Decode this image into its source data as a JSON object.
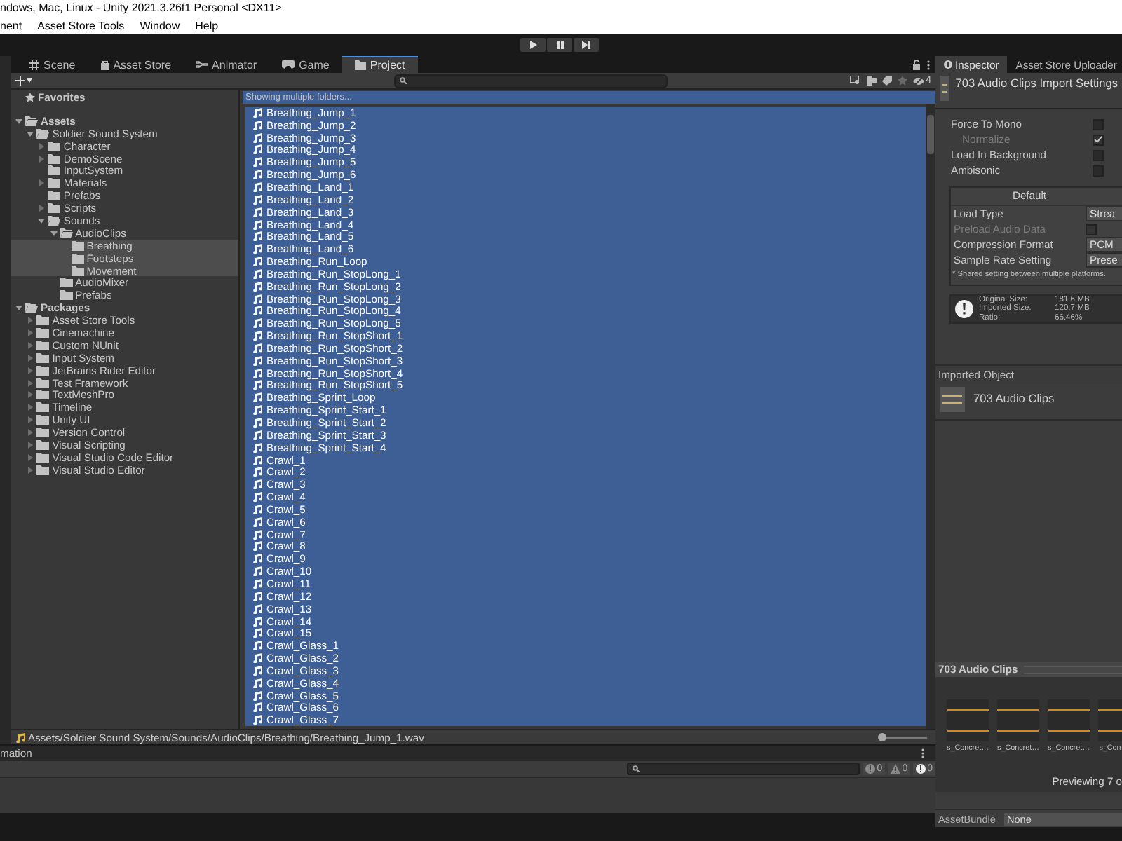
{
  "window": {
    "title": "ndows, Mac, Linux - Unity 2021.3.26f1 Personal <DX11>"
  },
  "menu": [
    "nent",
    "Asset Store Tools",
    "Window",
    "Help"
  ],
  "tabs": [
    {
      "label": "Scene",
      "kind": "scene",
      "selected": false
    },
    {
      "label": "Asset Store",
      "kind": "store",
      "selected": false
    },
    {
      "label": "Animator",
      "kind": "animator",
      "selected": false
    },
    {
      "label": "Game",
      "kind": "game",
      "selected": false
    },
    {
      "label": "Project",
      "kind": "project",
      "selected": true
    }
  ],
  "project_toolbar": {
    "hidden_count": "4"
  },
  "tree": [
    {
      "label": "Favorites",
      "kind": "favorites",
      "selected": false
    },
    {
      "label": "Assets",
      "kind": "folder",
      "expanded": true,
      "selected": false,
      "children": [
        {
          "label": "Soldier Sound System",
          "kind": "folder",
          "expanded": true,
          "selected": false,
          "children": [
            {
              "label": "Character",
              "kind": "folder",
              "expanded": false,
              "selected": false
            },
            {
              "label": "DemoScene",
              "kind": "folder",
              "expanded": false,
              "selected": false
            },
            {
              "label": "InputSystem",
              "kind": "empty_folder",
              "selected": false
            },
            {
              "label": "Materials",
              "kind": "folder",
              "expanded": false,
              "selected": false
            },
            {
              "label": "Prefabs",
              "kind": "empty_folder",
              "selected": false
            },
            {
              "label": "Scripts",
              "kind": "folder",
              "expanded": false,
              "selected": false
            },
            {
              "label": "Sounds",
              "kind": "folder",
              "expanded": true,
              "selected": false,
              "children": [
                {
                  "label": "AudioClips",
                  "kind": "folder",
                  "expanded": true,
                  "selected": false,
                  "children": [
                    {
                      "label": "Breathing",
                      "kind": "empty_folder",
                      "selected": true
                    },
                    {
                      "label": "Footsteps",
                      "kind": "empty_folder",
                      "selected": true
                    },
                    {
                      "label": "Movement",
                      "kind": "empty_folder",
                      "selected": true
                    }
                  ]
                },
                {
                  "label": "AudioMixer",
                  "kind": "empty_folder",
                  "selected": false
                },
                {
                  "label": "Prefabs",
                  "kind": "empty_folder",
                  "selected": false
                }
              ]
            }
          ]
        }
      ]
    },
    {
      "label": "Packages",
      "kind": "folder",
      "expanded": true,
      "selected": false,
      "children": [
        {
          "label": "Asset Store Tools",
          "kind": "folder",
          "expanded": false,
          "selected": false
        },
        {
          "label": "Cinemachine",
          "kind": "folder",
          "expanded": false,
          "selected": false
        },
        {
          "label": "Custom NUnit",
          "kind": "folder",
          "expanded": false,
          "selected": false
        },
        {
          "label": "Input System",
          "kind": "folder",
          "expanded": false,
          "selected": false
        },
        {
          "label": "JetBrains Rider Editor",
          "kind": "folder",
          "expanded": false,
          "selected": false
        },
        {
          "label": "Test Framework",
          "kind": "folder",
          "expanded": false,
          "selected": false
        },
        {
          "label": "TextMeshPro",
          "kind": "folder",
          "expanded": false,
          "selected": false
        },
        {
          "label": "Timeline",
          "kind": "folder",
          "expanded": false,
          "selected": false
        },
        {
          "label": "Unity UI",
          "kind": "folder",
          "expanded": false,
          "selected": false
        },
        {
          "label": "Version Control",
          "kind": "folder",
          "expanded": false,
          "selected": false
        },
        {
          "label": "Visual Scripting",
          "kind": "folder",
          "expanded": false,
          "selected": false
        },
        {
          "label": "Visual Studio Code Editor",
          "kind": "folder",
          "expanded": false,
          "selected": false
        },
        {
          "label": "Visual Studio Editor",
          "kind": "folder",
          "expanded": false,
          "selected": false
        }
      ]
    }
  ],
  "files": {
    "header": "Showing multiple folders...",
    "items": [
      {
        "name": "Breathing_Jump_1",
        "selected": true
      },
      {
        "name": "Breathing_Jump_2",
        "selected": true
      },
      {
        "name": "Breathing_Jump_3",
        "selected": true
      },
      {
        "name": "Breathing_Jump_4",
        "selected": true
      },
      {
        "name": "Breathing_Jump_5",
        "selected": true
      },
      {
        "name": "Breathing_Jump_6",
        "selected": true
      },
      {
        "name": "Breathing_Land_1",
        "selected": true
      },
      {
        "name": "Breathing_Land_2",
        "selected": true
      },
      {
        "name": "Breathing_Land_3",
        "selected": true
      },
      {
        "name": "Breathing_Land_4",
        "selected": true
      },
      {
        "name": "Breathing_Land_5",
        "selected": true
      },
      {
        "name": "Breathing_Land_6",
        "selected": true
      },
      {
        "name": "Breathing_Run_Loop",
        "selected": true
      },
      {
        "name": "Breathing_Run_StopLong_1",
        "selected": true
      },
      {
        "name": "Breathing_Run_StopLong_2",
        "selected": true
      },
      {
        "name": "Breathing_Run_StopLong_3",
        "selected": true
      },
      {
        "name": "Breathing_Run_StopLong_4",
        "selected": true
      },
      {
        "name": "Breathing_Run_StopLong_5",
        "selected": true
      },
      {
        "name": "Breathing_Run_StopShort_1",
        "selected": true
      },
      {
        "name": "Breathing_Run_StopShort_2",
        "selected": true
      },
      {
        "name": "Breathing_Run_StopShort_3",
        "selected": true
      },
      {
        "name": "Breathing_Run_StopShort_4",
        "selected": true
      },
      {
        "name": "Breathing_Run_StopShort_5",
        "selected": true
      },
      {
        "name": "Breathing_Sprint_Loop",
        "selected": true
      },
      {
        "name": "Breathing_Sprint_Start_1",
        "selected": true
      },
      {
        "name": "Breathing_Sprint_Start_2",
        "selected": true
      },
      {
        "name": "Breathing_Sprint_Start_3",
        "selected": true
      },
      {
        "name": "Breathing_Sprint_Start_4",
        "selected": true
      },
      {
        "name": "Crawl_1",
        "selected": true
      },
      {
        "name": "Crawl_2",
        "selected": true
      },
      {
        "name": "Crawl_3",
        "selected": true
      },
      {
        "name": "Crawl_4",
        "selected": true
      },
      {
        "name": "Crawl_5",
        "selected": true
      },
      {
        "name": "Crawl_6",
        "selected": true
      },
      {
        "name": "Crawl_7",
        "selected": true
      },
      {
        "name": "Crawl_8",
        "selected": true
      },
      {
        "name": "Crawl_9",
        "selected": true
      },
      {
        "name": "Crawl_10",
        "selected": true
      },
      {
        "name": "Crawl_11",
        "selected": true
      },
      {
        "name": "Crawl_12",
        "selected": true
      },
      {
        "name": "Crawl_13",
        "selected": true
      },
      {
        "name": "Crawl_14",
        "selected": true
      },
      {
        "name": "Crawl_15",
        "selected": true
      },
      {
        "name": "Crawl_Glass_1",
        "selected": true
      },
      {
        "name": "Crawl_Glass_2",
        "selected": true
      },
      {
        "name": "Crawl_Glass_3",
        "selected": true
      },
      {
        "name": "Crawl_Glass_4",
        "selected": true
      },
      {
        "name": "Crawl_Glass_5",
        "selected": true
      },
      {
        "name": "Crawl_Glass_6",
        "selected": true
      },
      {
        "name": "Crawl_Glass_7",
        "selected": true
      }
    ],
    "path": "Assets/Soldier Sound System/Sounds/AudioClips/Breathing/Breathing_Jump_1.wav",
    "zoom": {
      "level": 0
    }
  },
  "console": {
    "tab": "mation",
    "counts": [
      {
        "kind": "info",
        "count": "0"
      },
      {
        "kind": "warning",
        "count": "0"
      },
      {
        "kind": "error",
        "count": "0"
      }
    ]
  },
  "inspector": {
    "tabs": [
      {
        "label": "Inspector",
        "selected": true
      },
      {
        "label": "Asset Store Uploader",
        "selected": false
      }
    ],
    "title": "703 Audio Clips Import Settings",
    "options": [
      {
        "label": "Force To Mono",
        "checked": false,
        "disabled": false,
        "children": [
          {
            "label": "Normalize",
            "checked": true,
            "disabled": true
          }
        ]
      },
      {
        "label": "Load In Background",
        "checked": false,
        "disabled": false
      },
      {
        "label": "Ambisonic",
        "checked": false,
        "disabled": false
      }
    ],
    "platform": {
      "title": "Default",
      "fields": [
        {
          "kind": "dropdown",
          "label": "Load Type",
          "value": "Strea",
          "disabled": false
        },
        {
          "kind": "checkbox",
          "label": "Preload Audio Data",
          "checked": false,
          "disabled": true
        },
        {
          "kind": "dropdown",
          "label": "Compression Format",
          "value": "PCM",
          "disabled": false
        },
        {
          "kind": "dropdown",
          "label": "Sample Rate Setting",
          "value": "Prese",
          "disabled": false
        }
      ],
      "note": "* Shared setting between multiple platforms."
    },
    "info": [
      {
        "label": "Original Size:",
        "value": "181.6 MB"
      },
      {
        "label": "Imported Size:",
        "value": "120.7 MB"
      },
      {
        "label": "Ratio:",
        "value": "66.46%"
      }
    ],
    "imported_object": {
      "heading": "Imported Object",
      "name": "703 Audio Clips"
    },
    "preview": {
      "title": "703 Audio Clips",
      "clips": [
        "s_Concret…",
        "s_Concret…",
        "s_Concret…",
        "s_Con"
      ],
      "status": "Previewing 7 o"
    },
    "asset_bundle": {
      "label": "AssetBundle",
      "value": "None"
    }
  }
}
